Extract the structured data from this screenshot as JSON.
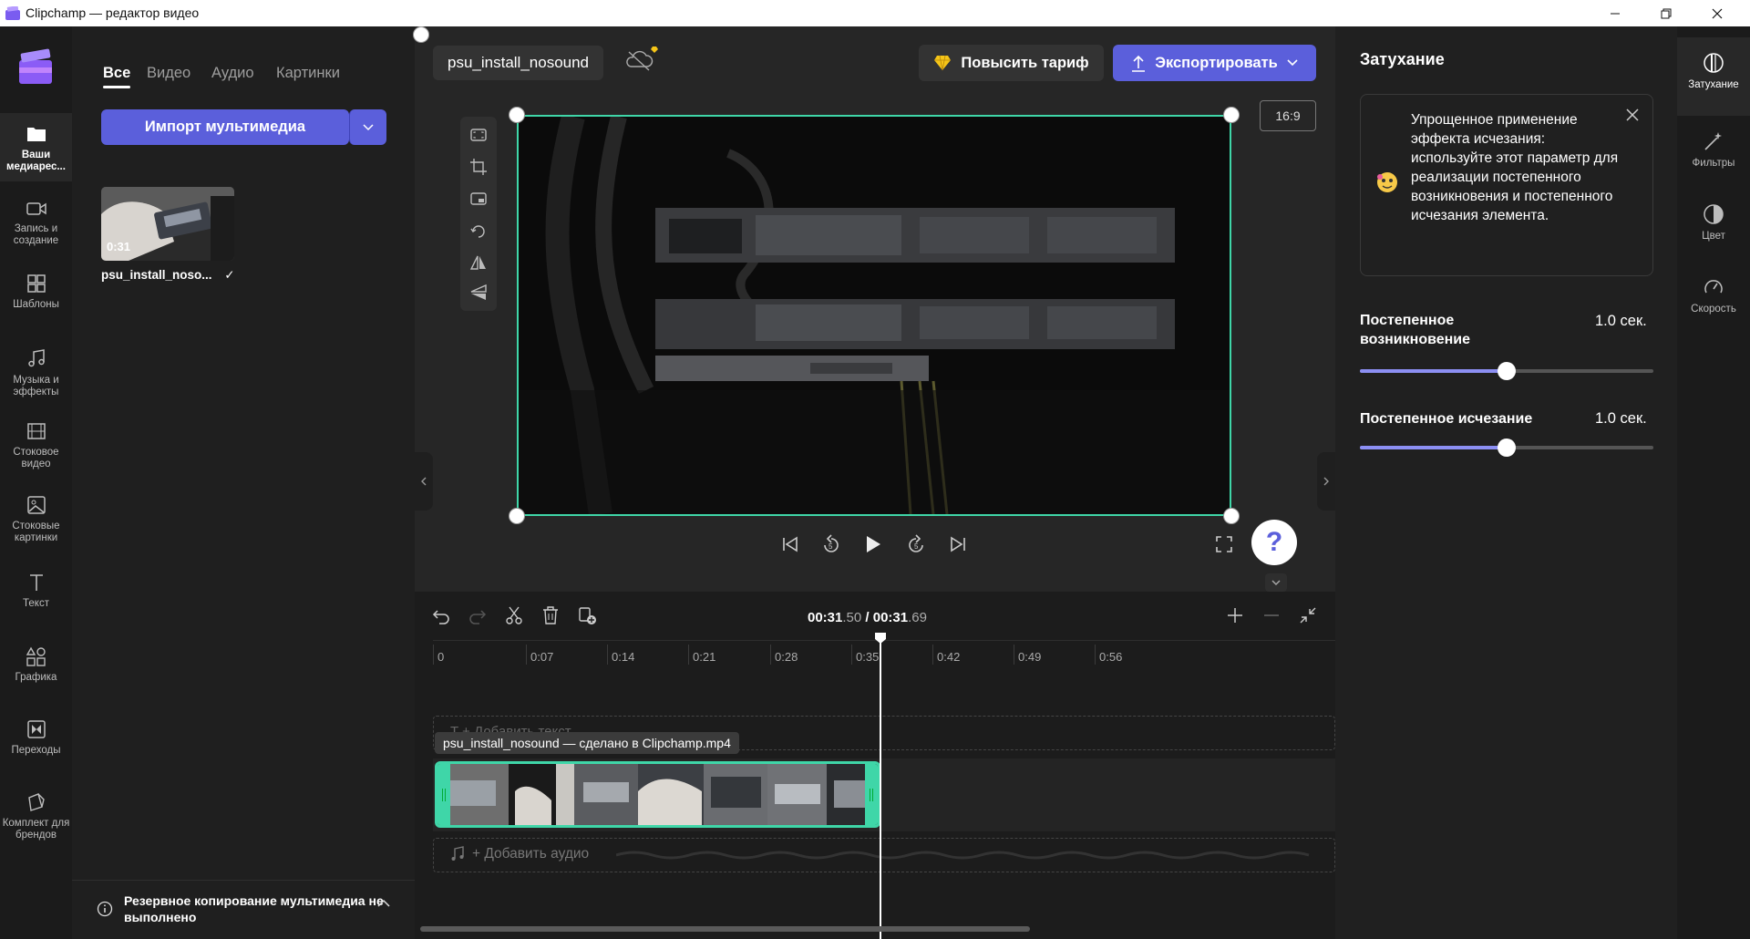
{
  "window": {
    "title": "Clipchamp — редактор видео"
  },
  "left_rail": {
    "items": [
      {
        "label": "Ваши медиарес...",
        "icon": "folder-icon"
      },
      {
        "label": "Запись и создание",
        "icon": "camera-icon"
      },
      {
        "label": "Шаблоны",
        "icon": "templates-icon"
      },
      {
        "label": "Музыка и эффекты",
        "icon": "music-icon"
      },
      {
        "label": "Стоковое видео",
        "icon": "film-icon"
      },
      {
        "label": "Стоковые картинки",
        "icon": "image-icon"
      },
      {
        "label": "Текст",
        "icon": "text-icon"
      },
      {
        "label": "Графика",
        "icon": "shapes-icon"
      },
      {
        "label": "Переходы",
        "icon": "transitions-icon"
      },
      {
        "label": "Комплект для брендов",
        "icon": "brand-kit-icon"
      }
    ]
  },
  "media_panel": {
    "tabs": [
      "Все",
      "Видео",
      "Аудио",
      "Картинки"
    ],
    "import_label": "Импорт мультимедиа",
    "media": [
      {
        "name": "psu_install_noso...",
        "duration": "0:31"
      }
    ],
    "backup_notice": "Резервное копирование мультимедиа не выполнено"
  },
  "editor": {
    "project_name": "psu_install_nosound",
    "upgrade_label": "Повысить тариф",
    "export_label": "Экспортировать",
    "aspect_ratio": "16:9",
    "help_label": "?"
  },
  "timeline": {
    "time_current_main": "00:31",
    "time_current_ms": ".50",
    "time_separator": " / ",
    "time_total_main": "00:31",
    "time_total_ms": ".69",
    "ruler_ticks": [
      "0",
      "0:07",
      "0:14",
      "0:21",
      "0:28",
      "0:35",
      "0:42",
      "0:49",
      "0:56"
    ],
    "text_track_placeholder": "T  + Добавить текст",
    "clip_label": "psu_install_nosound — сделано в Clipchamp.mp4",
    "audio_track_placeholder": "+ Добавить аудио"
  },
  "properties": {
    "title": "Затухание",
    "info_text": "Упрощенное применение эффекта исчезания: используйте этот параметр для реализации постепенного возникновения и постепенного исчезания элемента.",
    "fade_in_label": "Постепенное возникновение",
    "fade_in_value": "1.0 сек.",
    "fade_in_fraction": 0.5,
    "fade_out_label": "Постепенное исчезание",
    "fade_out_value": "1.0 сек.",
    "fade_out_fraction": 0.5
  },
  "right_rail": {
    "items": [
      {
        "label": "Затухание",
        "icon": "fade-icon"
      },
      {
        "label": "Фильтры",
        "icon": "filters-icon"
      },
      {
        "label": "Цвет",
        "icon": "color-icon"
      },
      {
        "label": "Скорость",
        "icon": "speed-icon"
      }
    ]
  },
  "colors": {
    "accent": "#5b5fdb",
    "selection": "#3fd6a8",
    "slider_fill": "#8c8ff3"
  }
}
